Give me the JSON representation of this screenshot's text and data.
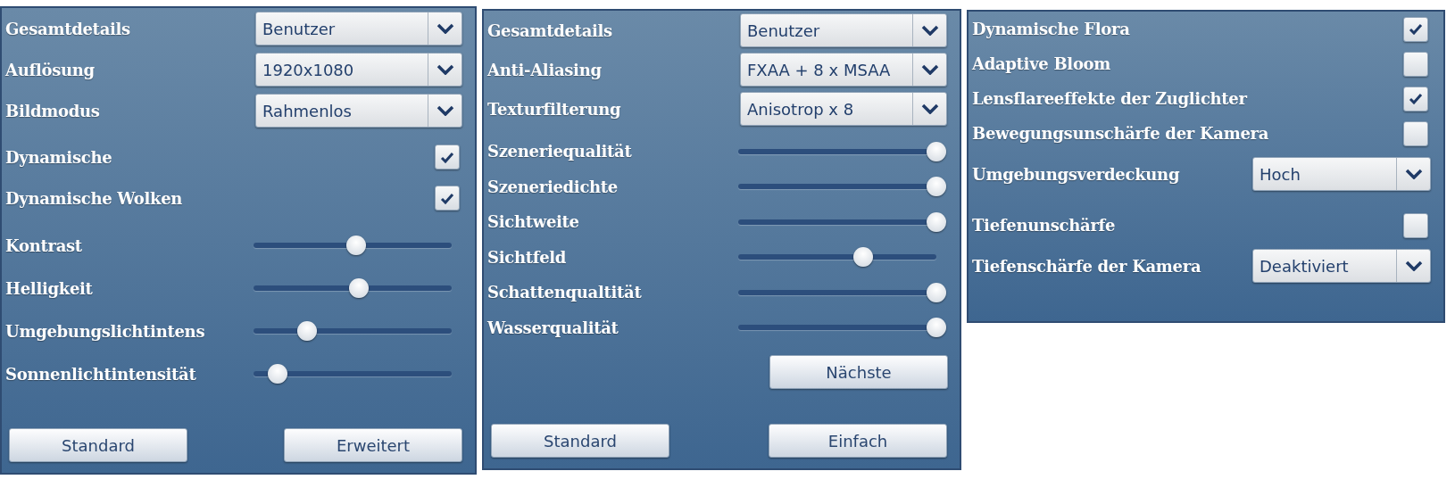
{
  "panels": [
    {
      "rows": [
        {
          "kind": "dropdown",
          "label": "Gesamtdetails",
          "value": "Benutzer"
        },
        {
          "kind": "dropdown",
          "label": "Auflösung",
          "value": "1920x1080"
        },
        {
          "kind": "dropdown",
          "label": "Bildmodus",
          "value": "Rahmenlos"
        },
        {
          "kind": "checkbox",
          "label": "Dynamische",
          "checked": true
        },
        {
          "kind": "checkbox",
          "label": "Dynamische Wolken",
          "checked": true
        },
        {
          "kind": "slider",
          "label": "Kontrast",
          "level": 0.52
        },
        {
          "kind": "slider",
          "label": "Helligkeit",
          "level": 0.53
        },
        {
          "kind": "slider",
          "label": "Umgebungslichtintens",
          "level": 0.27
        },
        {
          "kind": "slider",
          "label": "Sonnenlichtintensität",
          "level": 0.12
        }
      ],
      "buttons": [
        "Standard",
        "Erweitert"
      ]
    },
    {
      "rows": [
        {
          "kind": "dropdown",
          "label": "Gesamtdetails",
          "value": "Benutzer"
        },
        {
          "kind": "dropdown",
          "label": "Anti-Aliasing",
          "value": "FXAA + 8 x MSAA"
        },
        {
          "kind": "dropdown",
          "label": "Texturfilterung",
          "value": "Anisotrop x 8"
        },
        {
          "kind": "slider",
          "label": "Szeneriequalität",
          "level": 1
        },
        {
          "kind": "slider",
          "label": "Szeneriedichte",
          "level": 1
        },
        {
          "kind": "slider",
          "label": "Sichtweite",
          "level": 1
        },
        {
          "kind": "slider",
          "label": "Sichtfeld",
          "level": 0.63
        },
        {
          "kind": "slider",
          "label": "Schattenqualtität",
          "level": 1
        },
        {
          "kind": "slider",
          "label": "Wasserqualität",
          "level": 1
        },
        {
          "kind": "button",
          "label": "Nächste"
        }
      ],
      "buttons": [
        "Standard",
        "Einfach"
      ]
    },
    {
      "rows": [
        {
          "kind": "checkbox",
          "label": "Dynamische Flora",
          "checked": true
        },
        {
          "kind": "checkbox",
          "label": "Adaptive Bloom",
          "checked": false
        },
        {
          "kind": "checkbox",
          "label": "Lensflareeffekte der Zuglichter",
          "checked": true
        },
        {
          "kind": "checkbox",
          "label": "Bewegungsunschärfe der Kamera",
          "checked": false
        },
        {
          "kind": "dropdown",
          "label": "Umgebungsverdeckung",
          "value": "Hoch"
        },
        {
          "kind": "checkbox",
          "label": "Tiefenunschärfe",
          "checked": false
        },
        {
          "kind": "dropdown",
          "label": "Tiefenschärfe der Kamera",
          "value": "Deaktiviert"
        }
      ]
    }
  ]
}
